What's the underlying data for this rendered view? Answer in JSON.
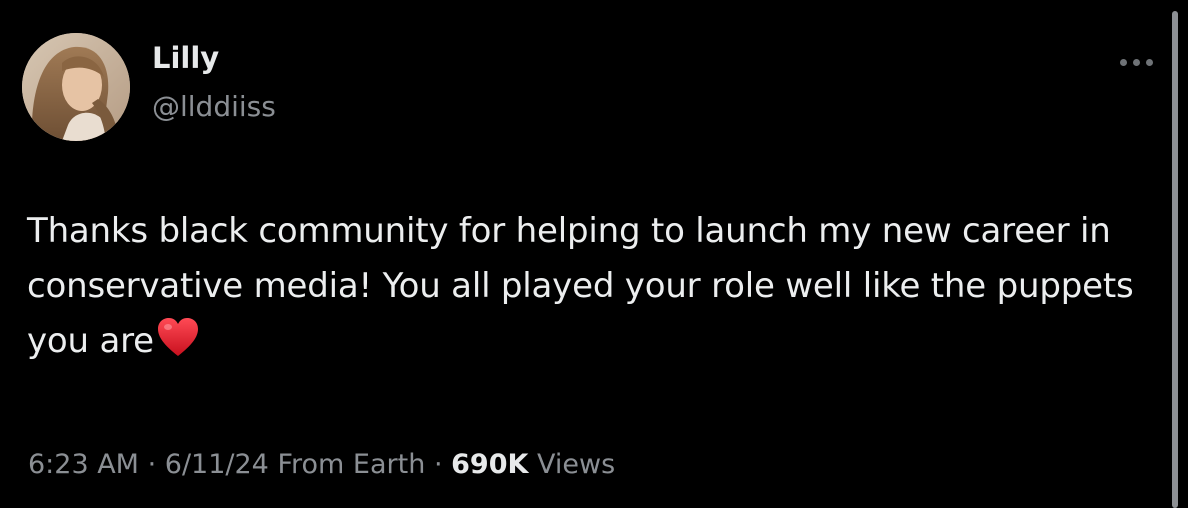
{
  "user": {
    "display_name": "Lilly",
    "handle": "@llddiiss"
  },
  "tweet": {
    "text": "Thanks black community for helping to launch my new career in conservative media! You all played your role well like the puppets you are",
    "emoji": "red-heart"
  },
  "meta": {
    "time": "6:23 AM",
    "separator": "·",
    "date": "6/11/24",
    "source": "From Earth",
    "views_count": "690K",
    "views_label": "Views"
  },
  "icons": {
    "more": "more-horizontal-icon",
    "heart": "red-heart-icon"
  },
  "colors": {
    "background": "#000000",
    "text": "#e7e9ea",
    "muted": "#8b8f94",
    "heart": "#e0202e"
  }
}
